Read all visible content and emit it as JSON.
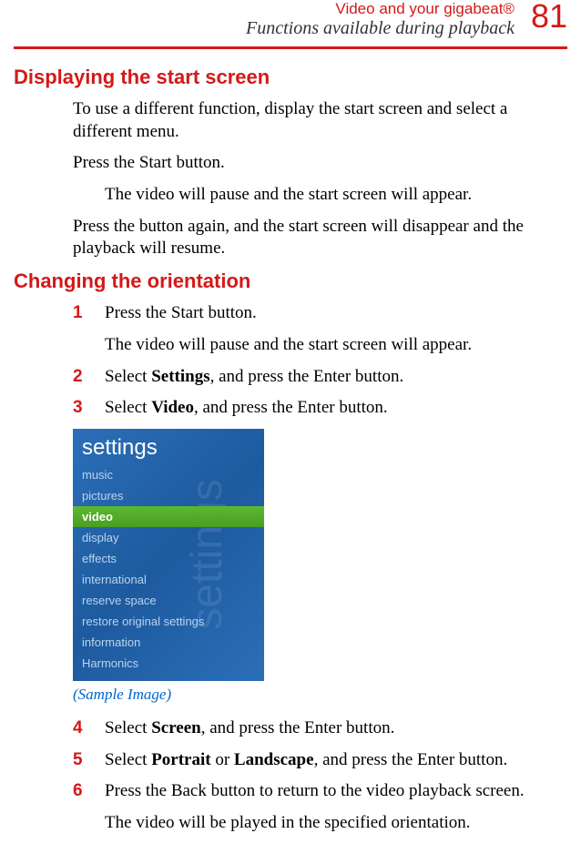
{
  "header": {
    "line1": "Video and your gigabeat®",
    "line2": "Functions available during playback",
    "page_number": "81"
  },
  "section1": {
    "heading": "Displaying the start screen",
    "p1": "To use a different function, display the start screen and select a different menu.",
    "p2": "Press the Start button.",
    "p3": "The video will pause and the start screen will appear.",
    "p4": "Press the button again, and the start screen will disappear and the playback will resume."
  },
  "section2": {
    "heading": "Changing the orientation",
    "steps": {
      "s1": {
        "num": "1",
        "pre": "Press the Start button."
      },
      "s1_follow": "The video will pause and the start screen will appear.",
      "s2": {
        "num": "2",
        "pre": "Select ",
        "bold": "Settings",
        "post": ", and press the Enter button."
      },
      "s3": {
        "num": "3",
        "pre": "Select ",
        "bold": "Video",
        "post": ", and press the Enter button."
      },
      "s4": {
        "num": "4",
        "pre": "Select ",
        "bold": "Screen",
        "post": ", and press the Enter button."
      },
      "s5": {
        "num": "5",
        "pre": "Select ",
        "bold1": "Portrait",
        "mid": " or ",
        "bold2": "Landscape",
        "post": ", and press the Enter button."
      },
      "s6": {
        "num": "6",
        "pre": "Press the Back button to return to the video playback screen."
      },
      "s6_follow": "The video will be played in the specified orientation."
    }
  },
  "screenshot": {
    "title": "settings",
    "items": [
      "music",
      "pictures",
      "video",
      "display",
      "effects",
      "international",
      "reserve space",
      "restore original settings",
      "information",
      "Harmonics"
    ],
    "selected_index": 2,
    "caption": "(Sample Image)"
  }
}
